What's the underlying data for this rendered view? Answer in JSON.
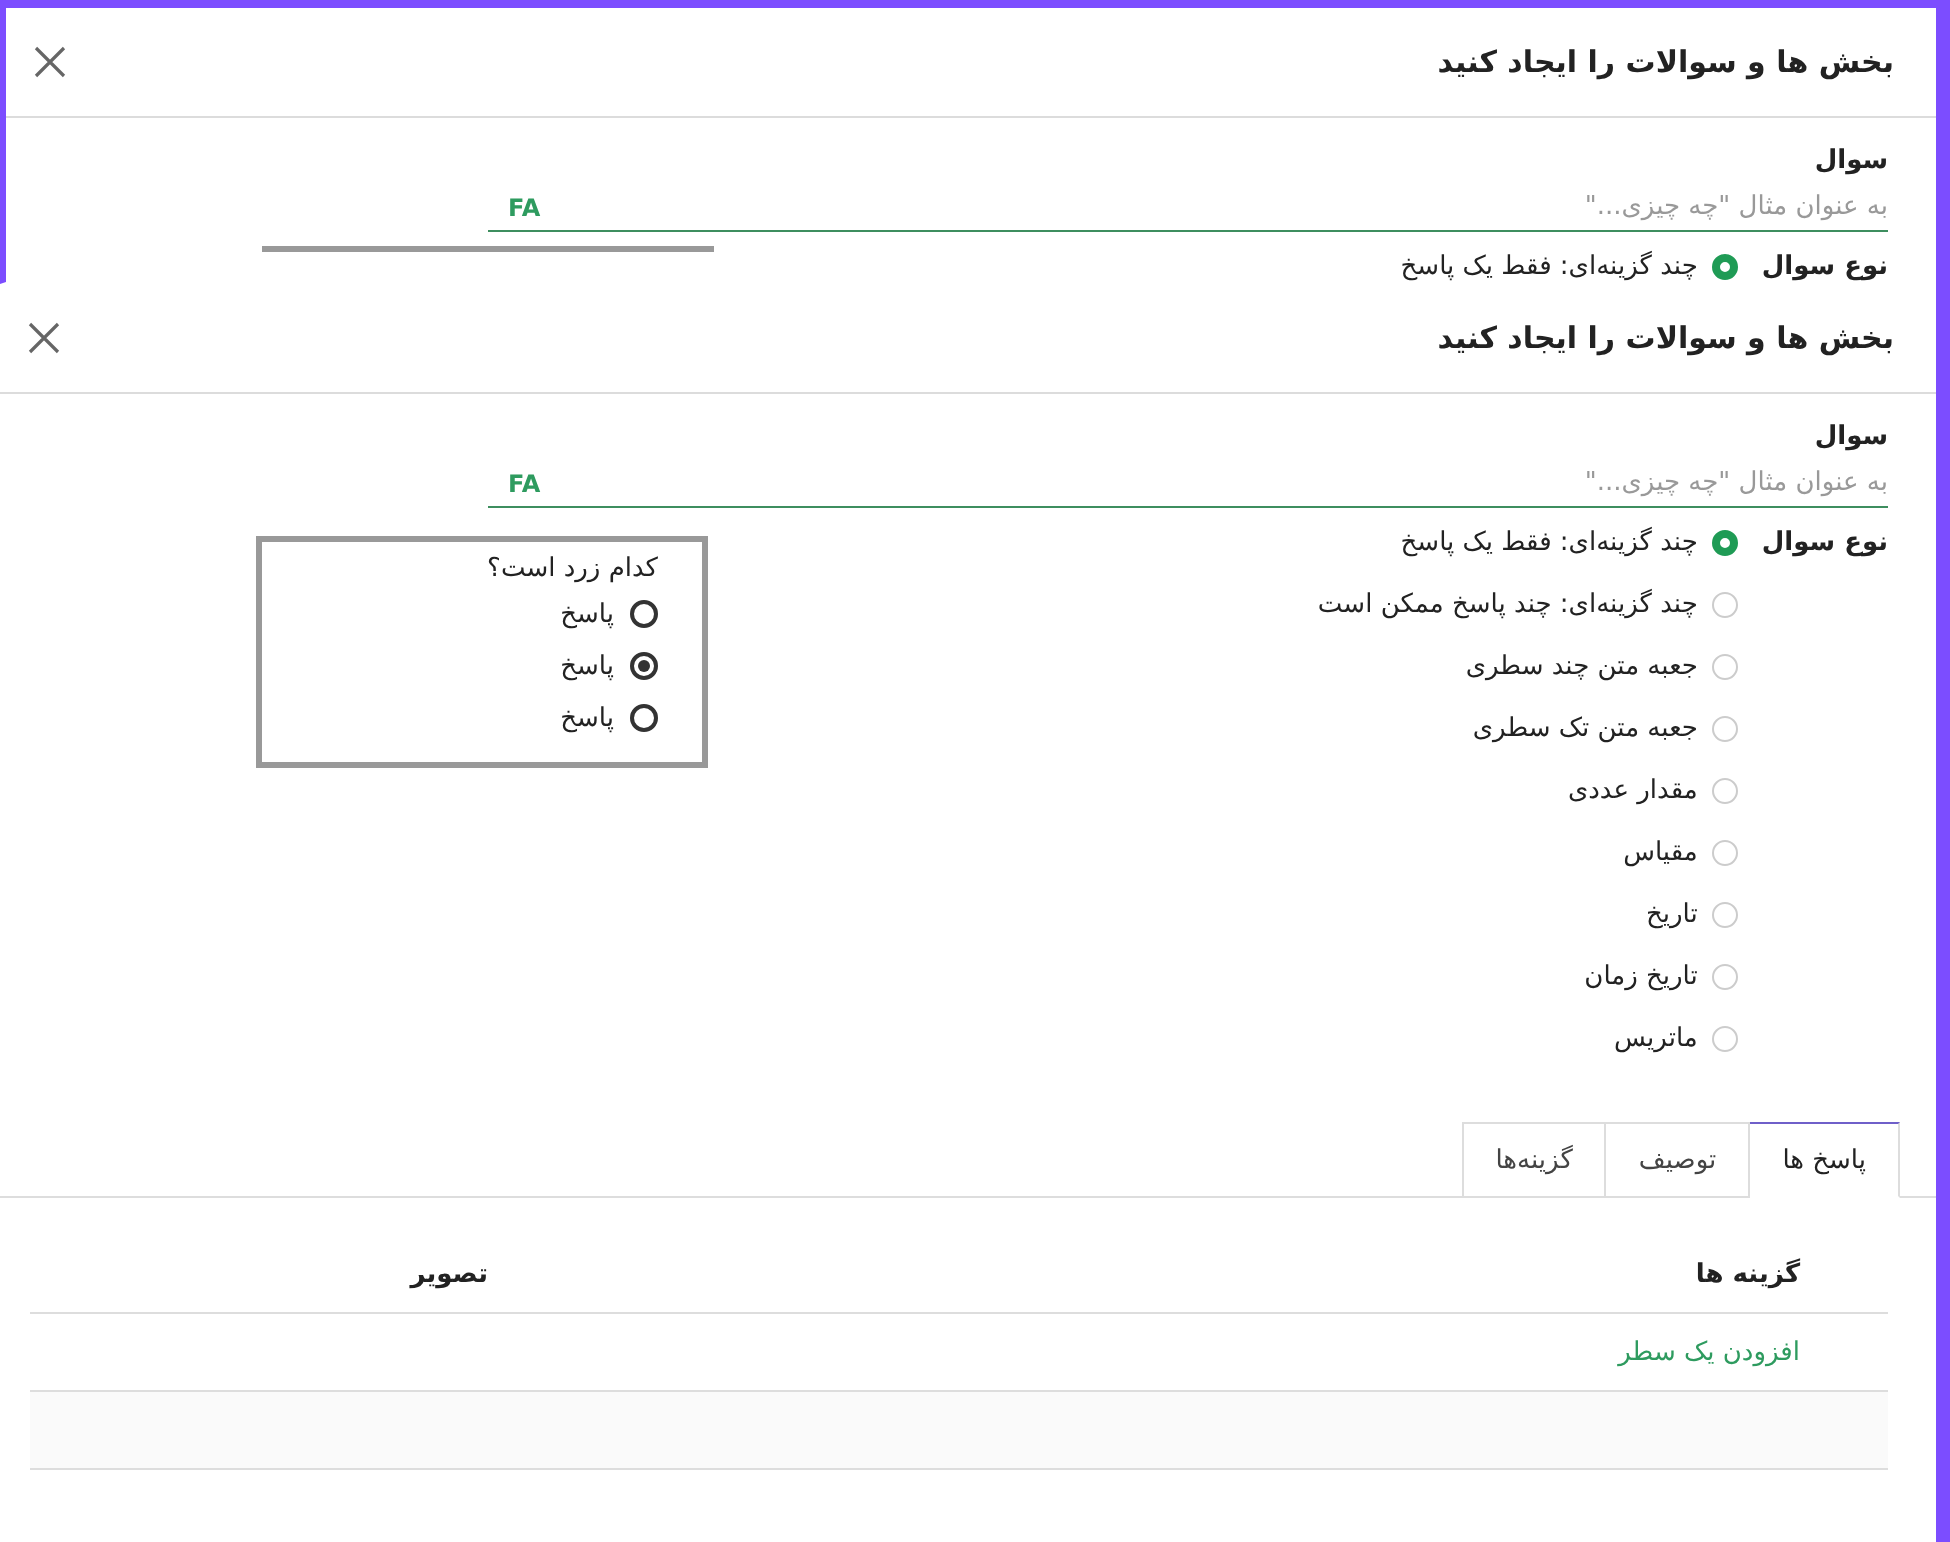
{
  "dialogs": [
    {
      "title": "بخش ها و سوالات را ایجاد کنید",
      "question_label": "سوال",
      "question_field": {
        "placeholder": "به عنوان مثال \"چه چیزی...\"",
        "lang_badge": "FA"
      },
      "type_label": "نوع سوال",
      "clipped": true,
      "question_types": [
        {
          "label": "چند گزینه‌ای: فقط یک پاسخ",
          "selected": true
        }
      ]
    },
    {
      "title": "بخش ها و سوالات را ایجاد کنید",
      "question_label": "سوال",
      "question_field": {
        "placeholder": "به عنوان مثال \"چه چیزی...\"",
        "lang_badge": "FA"
      },
      "type_label": "نوع سوال",
      "clipped": false,
      "question_types": [
        {
          "label": "چند گزینه‌ای: فقط یک پاسخ",
          "selected": true
        },
        {
          "label": "چند گزینه‌ای: چند پاسخ ممکن است",
          "selected": false
        },
        {
          "label": "جعبه متن چند سطری",
          "selected": false
        },
        {
          "label": "جعبه متن تک سطری",
          "selected": false
        },
        {
          "label": "مقدار عددی",
          "selected": false
        },
        {
          "label": "مقیاس",
          "selected": false
        },
        {
          "label": "تاریخ",
          "selected": false
        },
        {
          "label": "تاریخ زمان",
          "selected": false
        },
        {
          "label": "ماتریس",
          "selected": false
        }
      ],
      "preview": {
        "question": "کدام زرد است؟",
        "answers": [
          {
            "label": "پاسخ",
            "selected": false
          },
          {
            "label": "پاسخ",
            "selected": true
          },
          {
            "label": "پاسخ",
            "selected": false
          }
        ]
      },
      "tabs": [
        {
          "label": "پاسخ ها",
          "selected": true
        },
        {
          "label": "توصیف",
          "selected": false
        },
        {
          "label": "گزینه‌ها",
          "selected": false
        }
      ],
      "table": {
        "columns": [
          "گزینه ها",
          "تصویر"
        ],
        "add_line": "افزودن یک سطر"
      }
    }
  ]
}
